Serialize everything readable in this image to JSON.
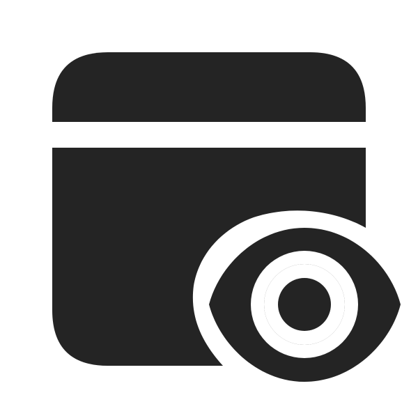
{
  "icon": {
    "name": "app-window-eye-icon",
    "colors": {
      "fill": "#242424",
      "background": "#ffffff"
    }
  }
}
